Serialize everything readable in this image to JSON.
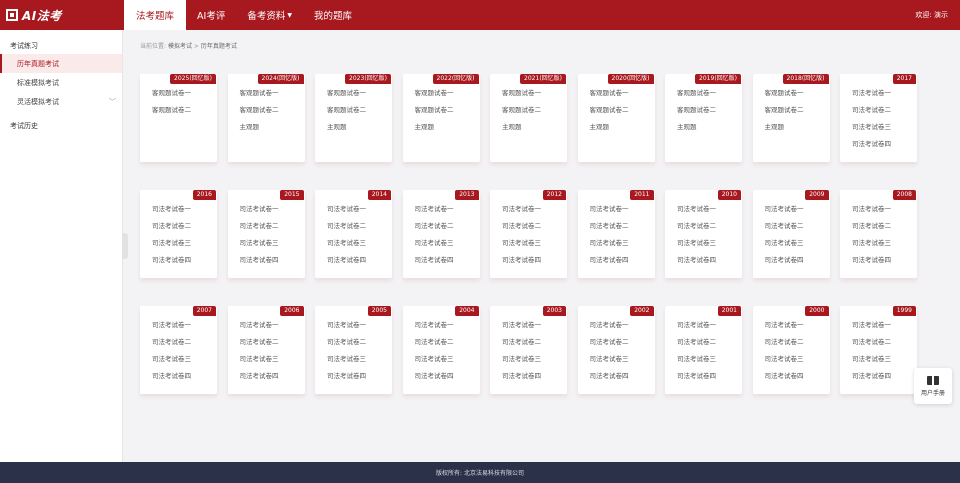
{
  "brand": {
    "logo_text": "AI法考"
  },
  "nav": [
    {
      "label": "法考题库",
      "active": true
    },
    {
      "label": "AI考评",
      "active": false
    },
    {
      "label": "备考资料",
      "active": false,
      "caret": "▼"
    },
    {
      "label": "我的题库",
      "active": false
    }
  ],
  "welcome": "欢迎: 演示",
  "sidebar": {
    "group_title": "考试练习",
    "items": [
      {
        "label": "历年真题考试",
        "active": true
      },
      {
        "label": "标准模拟考试",
        "active": false
      },
      {
        "label": "灵活模拟考试",
        "active": false,
        "chevron": "﹀"
      }
    ],
    "history": "考试历史"
  },
  "breadcrumb": {
    "prefix": "当前位置:",
    "items": [
      "模拟考试",
      "历年真题考试"
    ],
    "sep": ">"
  },
  "cards": [
    {
      "year": "2025(回忆版)",
      "items": [
        "客观题试卷一",
        "客观题试卷二"
      ]
    },
    {
      "year": "2024(回忆版)",
      "items": [
        "客观题试卷一",
        "客观题试卷二",
        "主观题"
      ]
    },
    {
      "year": "2023(回忆版)",
      "items": [
        "客观题试卷一",
        "客观题试卷二",
        "主观题"
      ]
    },
    {
      "year": "2022(回忆版)",
      "items": [
        "客观题试卷一",
        "客观题试卷二",
        "主观题"
      ]
    },
    {
      "year": "2021(回忆版)",
      "items": [
        "客观题试卷一",
        "客观题试卷二",
        "主观题"
      ]
    },
    {
      "year": "2020(回忆版)",
      "items": [
        "客观题试卷一",
        "客观题试卷二",
        "主观题"
      ]
    },
    {
      "year": "2019(回忆版)",
      "items": [
        "客观题试卷一",
        "客观题试卷二",
        "主观题"
      ]
    },
    {
      "year": "2018(回忆版)",
      "items": [
        "客观题试卷一",
        "客观题试卷二",
        "主观题"
      ]
    },
    {
      "year": "2017",
      "items": [
        "司法考试卷一",
        "司法考试卷二",
        "司法考试卷三",
        "司法考试卷四"
      ]
    },
    {
      "year": "2016",
      "items": [
        "司法考试卷一",
        "司法考试卷二",
        "司法考试卷三",
        "司法考试卷四"
      ]
    },
    {
      "year": "2015",
      "items": [
        "司法考试卷一",
        "司法考试卷二",
        "司法考试卷三",
        "司法考试卷四"
      ]
    },
    {
      "year": "2014",
      "items": [
        "司法考试卷一",
        "司法考试卷二",
        "司法考试卷三",
        "司法考试卷四"
      ]
    },
    {
      "year": "2013",
      "items": [
        "司法考试卷一",
        "司法考试卷二",
        "司法考试卷三",
        "司法考试卷四"
      ]
    },
    {
      "year": "2012",
      "items": [
        "司法考试卷一",
        "司法考试卷二",
        "司法考试卷三",
        "司法考试卷四"
      ]
    },
    {
      "year": "2011",
      "items": [
        "司法考试卷一",
        "司法考试卷二",
        "司法考试卷三",
        "司法考试卷四"
      ]
    },
    {
      "year": "2010",
      "items": [
        "司法考试卷一",
        "司法考试卷二",
        "司法考试卷三",
        "司法考试卷四"
      ]
    },
    {
      "year": "2009",
      "items": [
        "司法考试卷一",
        "司法考试卷二",
        "司法考试卷三",
        "司法考试卷四"
      ]
    },
    {
      "year": "2008",
      "items": [
        "司法考试卷一",
        "司法考试卷二",
        "司法考试卷三",
        "司法考试卷四"
      ]
    },
    {
      "year": "2007",
      "items": [
        "司法考试卷一",
        "司法考试卷二",
        "司法考试卷三",
        "司法考试卷四"
      ]
    },
    {
      "year": "2006",
      "items": [
        "司法考试卷一",
        "司法考试卷二",
        "司法考试卷三",
        "司法考试卷四"
      ]
    },
    {
      "year": "2005",
      "items": [
        "司法考试卷一",
        "司法考试卷二",
        "司法考试卷三",
        "司法考试卷四"
      ]
    },
    {
      "year": "2004",
      "items": [
        "司法考试卷一",
        "司法考试卷二",
        "司法考试卷三",
        "司法考试卷四"
      ]
    },
    {
      "year": "2003",
      "items": [
        "司法考试卷一",
        "司法考试卷二",
        "司法考试卷三",
        "司法考试卷四"
      ]
    },
    {
      "year": "2002",
      "items": [
        "司法考试卷一",
        "司法考试卷二",
        "司法考试卷三",
        "司法考试卷四"
      ]
    },
    {
      "year": "2001",
      "items": [
        "司法考试卷一",
        "司法考试卷二",
        "司法考试卷三",
        "司法考试卷四"
      ]
    },
    {
      "year": "2000",
      "items": [
        "司法考试卷一",
        "司法考试卷二",
        "司法考试卷三",
        "司法考试卷四"
      ]
    },
    {
      "year": "1999",
      "items": [
        "司法考试卷一",
        "司法考试卷二",
        "司法考试卷三",
        "司法考试卷四"
      ]
    }
  ],
  "manual": {
    "label": "用户手册",
    "icon": "book-icon"
  },
  "footer": "版权所有: 北京法易科技有限公司",
  "colors": {
    "brand": "#a8181f",
    "footer": "#2b3149"
  }
}
